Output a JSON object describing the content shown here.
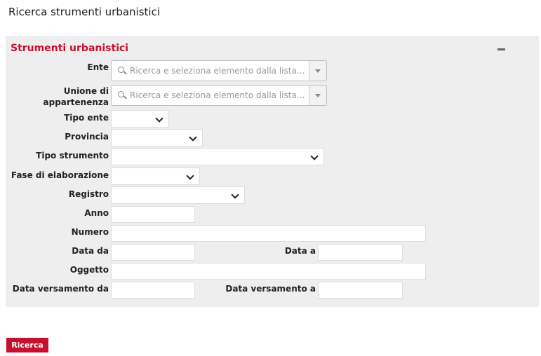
{
  "page": {
    "title": "Ricerca strumenti urbanistici"
  },
  "panel": {
    "title": "Strumenti urbanistici",
    "collapse_icon": "minus-icon"
  },
  "form": {
    "ente": {
      "label": "Ente",
      "placeholder": "Ricerca e seleziona elemento dalla lista..."
    },
    "unione": {
      "label_line1": "Unione di",
      "label_line2": "appartenenza",
      "placeholder": "Ricerca e seleziona elemento dalla lista..."
    },
    "tipo_ente": {
      "label": "Tipo ente",
      "value": ""
    },
    "provincia": {
      "label": "Provincia",
      "value": ""
    },
    "tipo_strumento": {
      "label": "Tipo strumento",
      "value": ""
    },
    "fase": {
      "label": "Fase di elaborazione",
      "value": ""
    },
    "registro": {
      "label": "Registro",
      "value": ""
    },
    "anno": {
      "label": "Anno",
      "value": ""
    },
    "numero": {
      "label": "Numero",
      "value": ""
    },
    "data_da": {
      "label": "Data da",
      "value": ""
    },
    "data_a": {
      "label": "Data a",
      "value": ""
    },
    "oggetto": {
      "label": "Oggetto",
      "value": ""
    },
    "data_versamento_da": {
      "label": "Data versamento da",
      "value": ""
    },
    "data_versamento_a": {
      "label": "Data versamento a",
      "value": ""
    }
  },
  "actions": {
    "search_label": "Ricerca"
  },
  "colors": {
    "accent": "#c8102e",
    "panel_bg": "#eeeeee"
  }
}
